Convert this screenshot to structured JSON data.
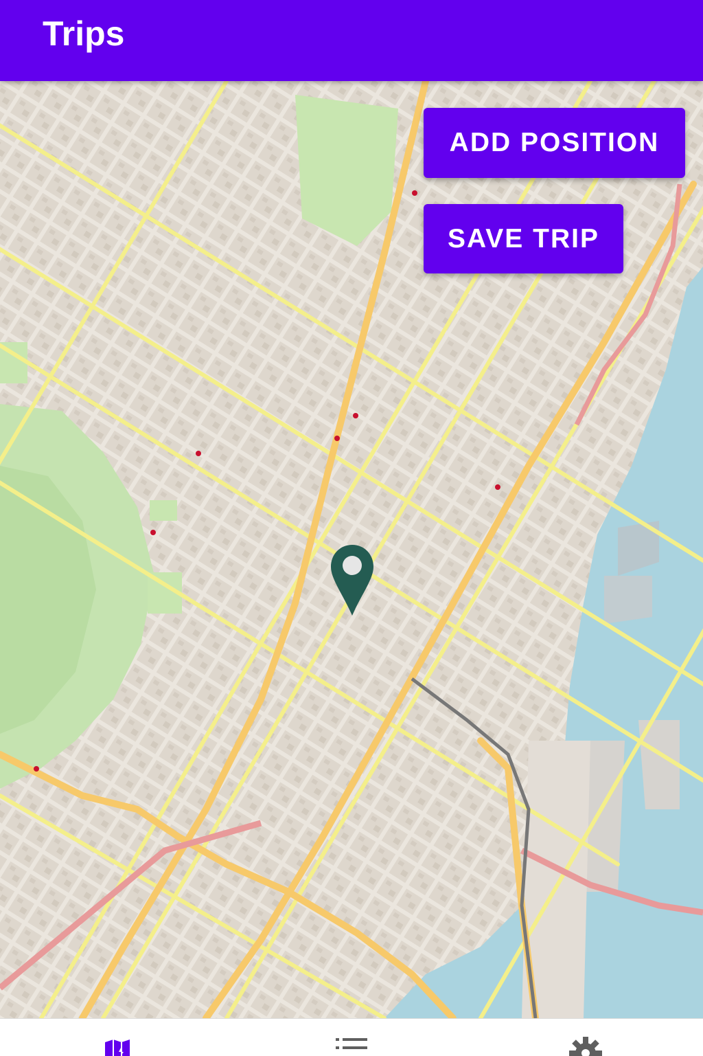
{
  "app": {
    "title": "Trips"
  },
  "actions": {
    "add_position": "ADD POSITION",
    "save_trip": "SAVE TRIP"
  },
  "bottom_nav": [
    {
      "icon": "map-icon",
      "active": true
    },
    {
      "icon": "list-icon",
      "active": false
    },
    {
      "icon": "settings-icon",
      "active": false
    }
  ],
  "colors": {
    "primary": "#6200ee",
    "marker": "#245c52",
    "poi": "#c8102e",
    "water": "#aad3df",
    "park": "#c8e6b0",
    "major_road": "#f7c96a",
    "secondary_road": "#f4ef8a"
  }
}
